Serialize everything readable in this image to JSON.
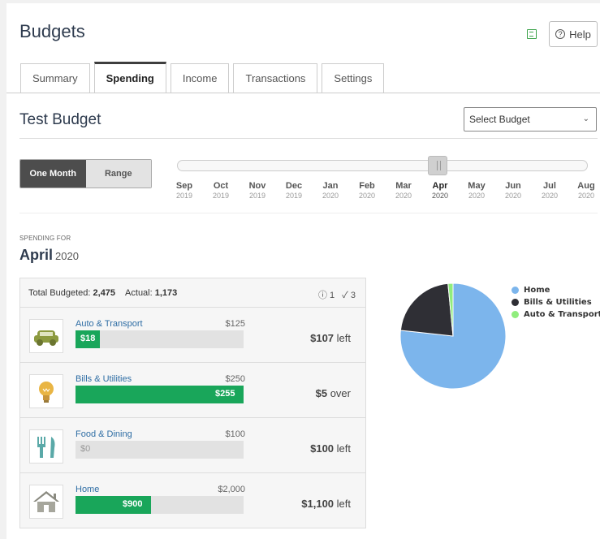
{
  "header": {
    "title": "Budgets",
    "help_label": "Help",
    "help_icon": "question-circle-icon",
    "copy_icon": "copy-icon"
  },
  "tabs": [
    {
      "label": "Summary",
      "active": false
    },
    {
      "label": "Spending",
      "active": true
    },
    {
      "label": "Income",
      "active": false
    },
    {
      "label": "Transactions",
      "active": false
    },
    {
      "label": "Settings",
      "active": false
    }
  ],
  "budget": {
    "name": "Test Budget",
    "select_label": "Select Budget"
  },
  "period_toggle": {
    "one_month": "One Month",
    "range": "Range",
    "selected": "One Month"
  },
  "timeline": {
    "months": [
      {
        "m": "Sep",
        "y": "2019"
      },
      {
        "m": "Oct",
        "y": "2019"
      },
      {
        "m": "Nov",
        "y": "2019"
      },
      {
        "m": "Dec",
        "y": "2019"
      },
      {
        "m": "Jan",
        "y": "2020"
      },
      {
        "m": "Feb",
        "y": "2020"
      },
      {
        "m": "Mar",
        "y": "2020"
      },
      {
        "m": "Apr",
        "y": "2020"
      },
      {
        "m": "May",
        "y": "2020"
      },
      {
        "m": "Jun",
        "y": "2020"
      },
      {
        "m": "Jul",
        "y": "2020"
      },
      {
        "m": "Aug",
        "y": "2020"
      }
    ],
    "selected": "Apr"
  },
  "spending": {
    "label": "SPENDING FOR",
    "month": "April",
    "year": "2020",
    "total_budgeted_label": "Total Budgeted:",
    "total_budgeted": "2,475",
    "actual_label": "Actual:",
    "actual": "1,173",
    "alerts_count": "1",
    "ok_count": "3",
    "categories": [
      {
        "name": "Auto & Transport",
        "budget": "$125",
        "spent": "$18",
        "fraction": 0.144,
        "remaining": "$107",
        "status": "left",
        "icon": "car-icon"
      },
      {
        "name": "Bills & Utilities",
        "budget": "$250",
        "spent": "$255",
        "fraction": 1.0,
        "remaining": "$5",
        "status": "over",
        "icon": "lightbulb-icon"
      },
      {
        "name": "Food & Dining",
        "budget": "$100",
        "spent": "$0",
        "fraction": 0.0,
        "remaining": "$100",
        "status": "left",
        "icon": "fork-knife-icon"
      },
      {
        "name": "Home",
        "budget": "$2,000",
        "spent": "$900",
        "fraction": 0.45,
        "remaining": "$1,100",
        "status": "left",
        "icon": "house-icon"
      }
    ]
  },
  "chart_data": {
    "type": "pie",
    "categories": [
      "Home",
      "Bills & Utilities",
      "Auto & Transport"
    ],
    "values": [
      900,
      255,
      18
    ],
    "colors": [
      "#7cb5ec",
      "#2f2f35",
      "#90ed7d"
    ],
    "legend_position": "right"
  }
}
